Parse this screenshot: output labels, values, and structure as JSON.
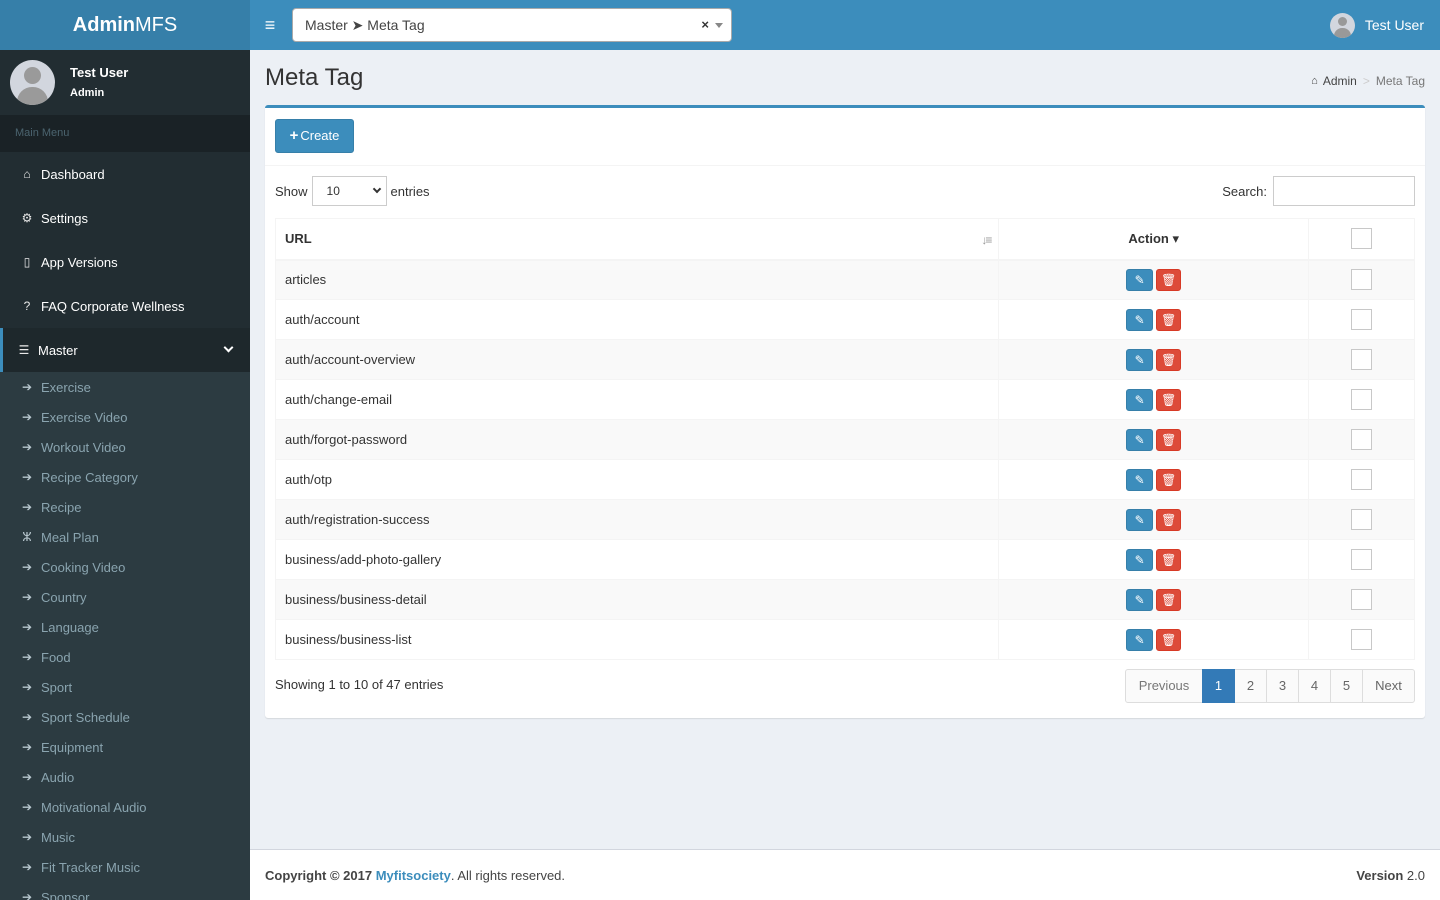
{
  "brand": {
    "bold": "Admin",
    "light": "MFS"
  },
  "quicknav": {
    "value": "Master ➤ Meta Tag",
    "clear": "×"
  },
  "topbar": {
    "user": "Test User"
  },
  "sidebar": {
    "user_name": "Test User",
    "user_role": "Admin",
    "menu_header": "Main Menu",
    "items": [
      {
        "label": "Dashboard",
        "icon": "home-icon"
      },
      {
        "label": "Settings",
        "icon": "gears-icon"
      },
      {
        "label": "App Versions",
        "icon": "mobile-icon"
      },
      {
        "label": "FAQ Corporate Wellness",
        "icon": "question-circle-icon"
      },
      {
        "label": "Master",
        "icon": "database-icon"
      }
    ],
    "subitems": [
      "Exercise",
      "Exercise Video",
      "Workout Video",
      "Recipe Category",
      "Recipe",
      "Meal Plan",
      "Cooking Video",
      "Country",
      "Language",
      "Food",
      "Sport",
      "Sport Schedule",
      "Equipment",
      "Audio",
      "Motivational Audio",
      "Music",
      "Fit Tracker Music",
      "Sponsor"
    ]
  },
  "page": {
    "title": "Meta Tag"
  },
  "breadcrumb": {
    "home": "Admin",
    "current": "Meta Tag"
  },
  "toolbar": {
    "create_label": "Create"
  },
  "table_controls": {
    "show_label": "Show",
    "entries_label": "entries",
    "page_length": "10",
    "search_label": "Search:"
  },
  "table": {
    "columns": {
      "url": "URL",
      "action": "Action"
    },
    "rows": [
      "articles",
      "auth/account",
      "auth/account-overview",
      "auth/change-email",
      "auth/forgot-password",
      "auth/otp",
      "auth/registration-success",
      "business/add-photo-gallery",
      "business/business-detail",
      "business/business-list"
    ]
  },
  "pagination": {
    "info": "Showing 1 to 10 of 47 entries",
    "previous": "Previous",
    "pages": [
      "1",
      "2",
      "3",
      "4",
      "5"
    ],
    "current": "1",
    "next": "Next"
  },
  "footer": {
    "copyright_prefix": "Copyright © 2017 ",
    "company": "Myfitsociety",
    "rights": ". All rights reserved.",
    "version_label": "Version",
    "version": "2.0"
  },
  "colors": {
    "primary": "#3c8dbc",
    "danger": "#dd4b39",
    "sidebar": "#222d32"
  }
}
